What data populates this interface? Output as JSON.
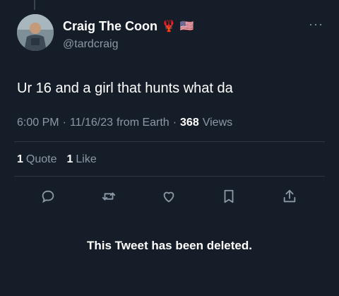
{
  "author": {
    "name": "Craig The Coon",
    "name_emojis": [
      "🦞",
      "🇺🇸"
    ],
    "handle": "@tardcraig"
  },
  "tweet": {
    "text": "Ur 16 and a girl that hunts what da",
    "time": "6:00 PM",
    "date": "11/16/23",
    "source": "from Earth",
    "views_count": "368",
    "views_label": "Views"
  },
  "stats": {
    "quotes_count": "1",
    "quotes_label": "Quote",
    "likes_count": "1",
    "likes_label": "Like"
  },
  "actions": [
    "reply-icon",
    "retweet-icon",
    "like-icon",
    "bookmark-icon",
    "share-icon"
  ],
  "notice": "This Tweet has been deleted.",
  "colors": {
    "background": "#151d28",
    "primary_text": "#ffffff",
    "secondary_text": "#8b98a5",
    "divider": "#2f3640"
  }
}
